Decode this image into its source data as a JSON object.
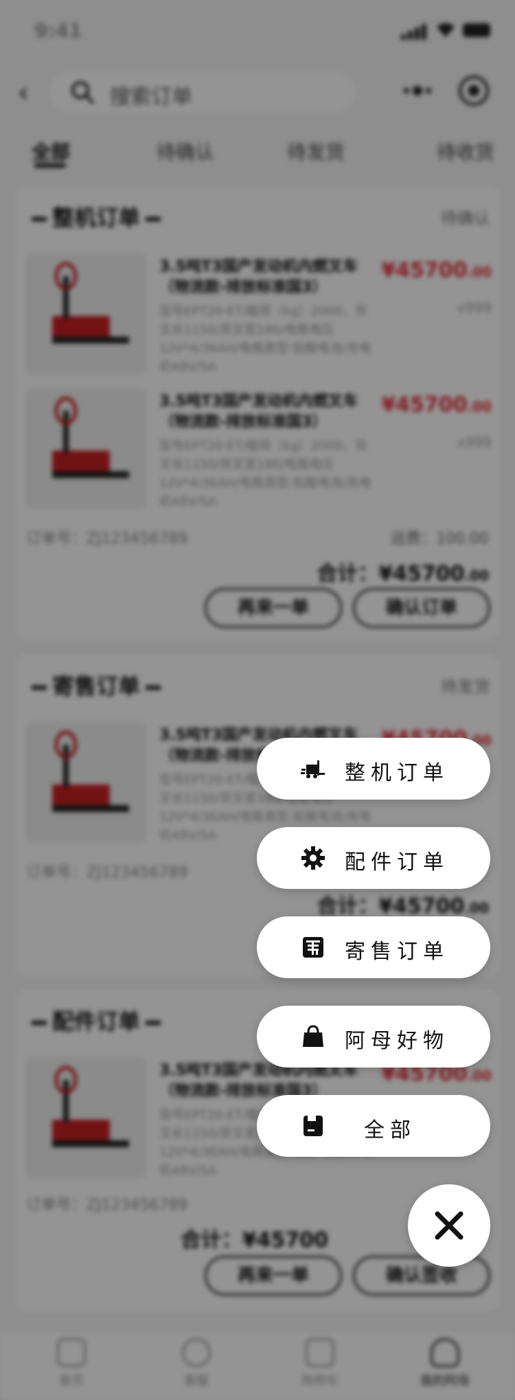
{
  "status": {
    "time": "9:41"
  },
  "search": {
    "placeholder": "搜索订单"
  },
  "tabs": [
    {
      "label": "全部"
    },
    {
      "label": "待确认"
    },
    {
      "label": "待发货"
    },
    {
      "label": "待收货"
    }
  ],
  "product": {
    "name": "3.5吨T3国产发动机内燃叉车（物流款-排放标准国3）",
    "spec": "型号EPT20-ET/载荷（kg）2000，货叉长1150/货叉宽180/电瓶电压12V*4/36AH/电瓶类型:铅酸电池/充电机48V/5A",
    "price_int": "¥45700",
    "price_dec": ".00",
    "qty": "x999"
  },
  "orders": [
    {
      "title": "整机订单",
      "status": "待确认",
      "order_no": "订单号：ZJ123456789",
      "freight": "运费：100.00",
      "total_int": "合计：¥45700",
      "total_dec": ".00",
      "btn_left": "再来一单",
      "btn_right": "确认订单"
    },
    {
      "title": "寄售订单",
      "status": "待发货",
      "order_no": "订单号：ZJ123456789",
      "total_int": "合计：¥45700",
      "total_dec": ".00"
    },
    {
      "title": "配件订单",
      "order_no": "订单号：ZJ123456789",
      "total_int": "合计：¥45700",
      "btn_left": "再来一单",
      "btn_right": "确认签收"
    }
  ],
  "bottom_nav": [
    {
      "label": "首页",
      "icon": "home-icon"
    },
    {
      "label": "客服",
      "icon": "headset-icon"
    },
    {
      "label": "购物车",
      "icon": "cart-icon"
    },
    {
      "label": "我的阿母",
      "icon": "user-icon"
    }
  ],
  "menu": [
    {
      "label": "整机订单",
      "icon": "forklift-icon"
    },
    {
      "label": "配件订单",
      "icon": "gear-icon"
    },
    {
      "label": "寄售订单",
      "icon": "consign-icon"
    },
    {
      "label": "阿母好物",
      "icon": "shopping-bag-icon"
    },
    {
      "label": "全部",
      "icon": "box-icon"
    }
  ],
  "close_icon": "close-icon"
}
